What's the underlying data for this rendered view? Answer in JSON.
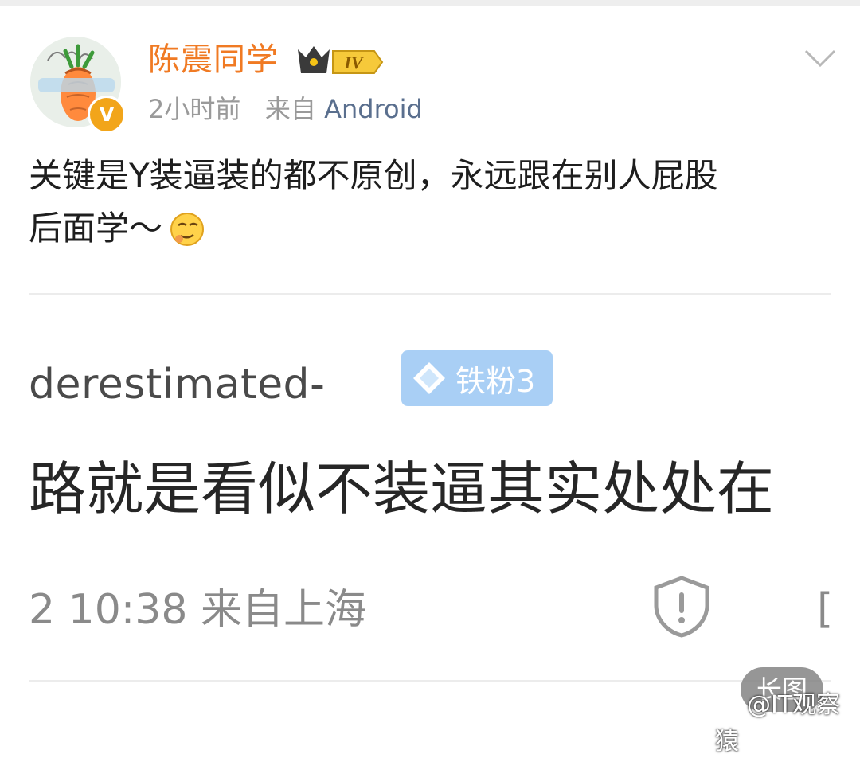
{
  "post": {
    "username": "陈震同学",
    "level_badge": "IV",
    "verified_badge": "V",
    "time": "2小时前",
    "source_prefix": "来自",
    "source": "Android",
    "text_line1": "关键是Y装逼装的都不原创，永远跟在别人屁股",
    "text_line2": "后面学～",
    "emoji": "smirk-face-icon"
  },
  "embedded": {
    "username": "derestimated-",
    "fan_badge": "铁粉3",
    "text": "路就是看似不装逼其实处处在",
    "meta": "2 10:38  来自上海",
    "bracket": "["
  },
  "overlay": {
    "long_image": "长图",
    "watermark": "@IT观察猿"
  },
  "colors": {
    "username": "#f07a23",
    "source_link": "#5a6f8e",
    "fan_badge_bg": "#a9cff5"
  }
}
